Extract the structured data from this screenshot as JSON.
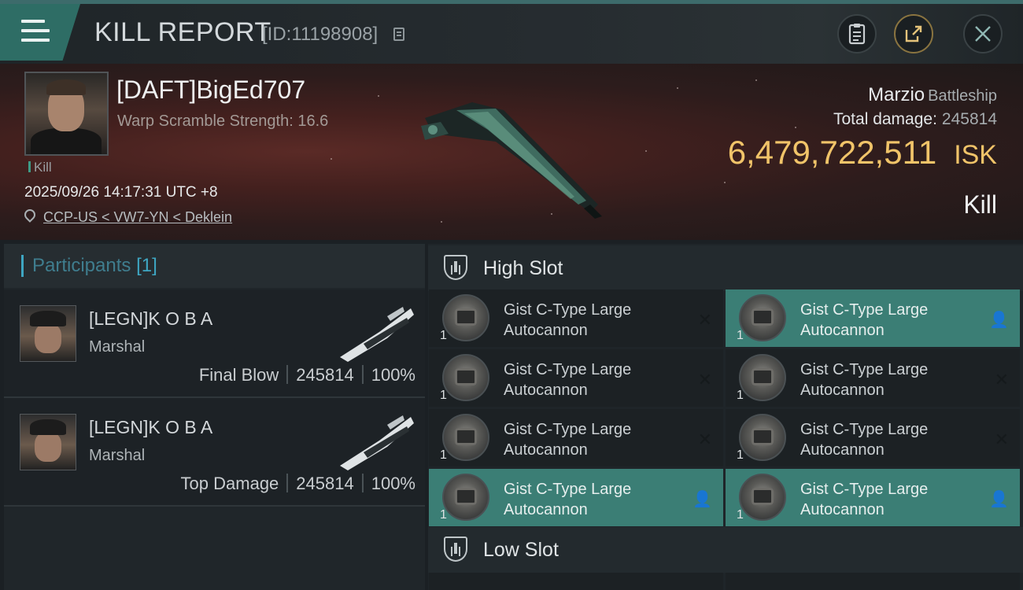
{
  "header": {
    "title": "KILL REPORT",
    "kill_id": "[ID:11198908]"
  },
  "victim": {
    "name": "[DAFT]BigEd707",
    "warp_scramble": "Warp Scramble Strength: 16.6",
    "badge": "Kill",
    "datetime": "2025/09/26 14:17:31 UTC +8",
    "location": "CCP-US < VW7-YN < Deklein",
    "ship_name": "Marzio",
    "ship_class": "Battleship",
    "total_damage_label": "Total damage:",
    "total_damage": "245814",
    "isk_value": "6,479,722,511",
    "isk_unit": "ISK",
    "type_label": "Kill"
  },
  "participants": {
    "label": "Participants",
    "count": "[1]",
    "items": [
      {
        "name": "[LEGN]K O B A",
        "ship": "Marshal",
        "role": "Final Blow",
        "damage": "245814",
        "percent": "100%"
      },
      {
        "name": "[LEGN]K O B A",
        "ship": "Marshal",
        "role": "Top Damage",
        "damage": "245814",
        "percent": "100%"
      }
    ]
  },
  "high_slot": {
    "label": "High Slot",
    "modules": [
      {
        "line1": "Gist C-Type Large",
        "line2": "Autocannon",
        "qty": "1",
        "status": "destroyed",
        "status_glyph": "✕"
      },
      {
        "line1": "Gist C-Type Large",
        "line2": "Autocannon",
        "qty": "1",
        "status": "dropped",
        "status_glyph": "👤"
      },
      {
        "line1": "Gist C-Type Large",
        "line2": "Autocannon",
        "qty": "1",
        "status": "destroyed",
        "status_glyph": "✕"
      },
      {
        "line1": "Gist C-Type Large",
        "line2": "Autocannon",
        "qty": "1",
        "status": "destroyed",
        "status_glyph": "✕"
      },
      {
        "line1": "Gist C-Type Large",
        "line2": "Autocannon",
        "qty": "1",
        "status": "destroyed",
        "status_glyph": "✕"
      },
      {
        "line1": "Gist C-Type Large",
        "line2": "Autocannon",
        "qty": "1",
        "status": "destroyed",
        "status_glyph": "✕"
      },
      {
        "line1": "Gist C-Type Large",
        "line2": "Autocannon",
        "qty": "1",
        "status": "dropped",
        "status_glyph": "👤"
      },
      {
        "line1": "Gist C-Type Large",
        "line2": "Autocannon",
        "qty": "1",
        "status": "dropped",
        "status_glyph": "👤"
      }
    ]
  },
  "low_slot": {
    "label": "Low Slot"
  },
  "colors": {
    "accent_teal": "#3b7e75",
    "isk_gold": "#f1c469",
    "participants_blue": "#3ea6c2"
  },
  "icons": [
    "menu-icon",
    "copy-icon",
    "clipboard-icon",
    "share-icon",
    "close-icon",
    "location-pin-icon",
    "high-slot-icon",
    "low-slot-icon"
  ]
}
